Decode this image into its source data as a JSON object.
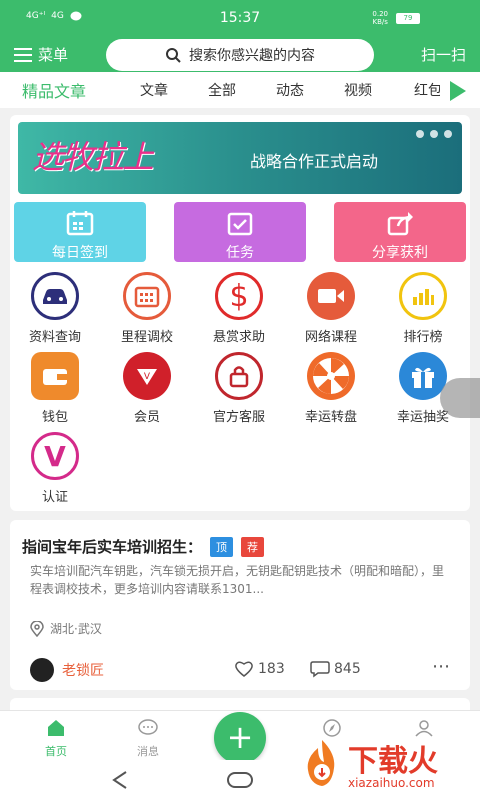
{
  "status": {
    "signal1": "4G⁺ᴵ",
    "signal2": "4G",
    "time": "15:37",
    "speed_value": "0.20",
    "speed_unit": "KB/s",
    "battery": "79"
  },
  "topbar": {
    "menu_label": "菜单",
    "search_placeholder": "搜索你感兴趣的内容",
    "scan_label": "扫一扫"
  },
  "tabs": [
    "精品文章",
    "文章",
    "全部",
    "动态",
    "视频",
    "红包"
  ],
  "banner": {
    "logo_text": "选牧拉上",
    "headline": "战略合作正式启动"
  },
  "quick": [
    {
      "label": "每日签到",
      "color": "#5fd3e6"
    },
    {
      "label": "任务",
      "color": "#c66be0"
    },
    {
      "label": "分享获利",
      "color": "#f3668a"
    }
  ],
  "grid": [
    {
      "label": "资料查询",
      "icon": "car-icon",
      "color": "#2d2f7a"
    },
    {
      "label": "里程调校",
      "icon": "calendar-grid-icon",
      "color": "#e55b3b"
    },
    {
      "label": "悬赏求助",
      "icon": "dollar-icon",
      "color": "#e02b2b"
    },
    {
      "label": "网络课程",
      "icon": "video-camera-icon",
      "color": "#e55b3b"
    },
    {
      "label": "排行榜",
      "icon": "bar-chart-icon",
      "color": "#f1c40f"
    },
    {
      "label": "钱包",
      "icon": "wallet-icon",
      "color": "#ef8a2c"
    },
    {
      "label": "会员",
      "icon": "vip-badge-icon",
      "color": "#d0202a"
    },
    {
      "label": "官方客服",
      "icon": "lock-icon",
      "color": "#c0262d"
    },
    {
      "label": "幸运转盘",
      "icon": "wheel-icon",
      "color": "#ef6a2a"
    },
    {
      "label": "幸运抽奖",
      "icon": "gift-icon",
      "color": "#2b88d8"
    },
    {
      "label": "认证",
      "icon": "verify-v-icon",
      "color": "#d42a8a"
    }
  ],
  "post": {
    "title": "指间宝年后实车培训招生：",
    "tag_top": "顶",
    "tag_top_color": "#2d8fe0",
    "tag_rec": "荐",
    "tag_rec_color": "#e8473c",
    "body": "实车培训配汽车钥匙，汽车锁无损开启，无钥匙配钥匙技术（明配和暗配），里程表调校技术，更多培训内容请联系1301...",
    "location": "湖北·武汉",
    "author": "老锁匠",
    "likes": "183",
    "comments": "845"
  },
  "bottomnav": [
    {
      "label": "首页"
    },
    {
      "label": "消息"
    },
    {
      "label": ""
    },
    {
      "label": ""
    }
  ],
  "watermark": {
    "title": "下载火",
    "url": "xiazaihuo.com"
  }
}
